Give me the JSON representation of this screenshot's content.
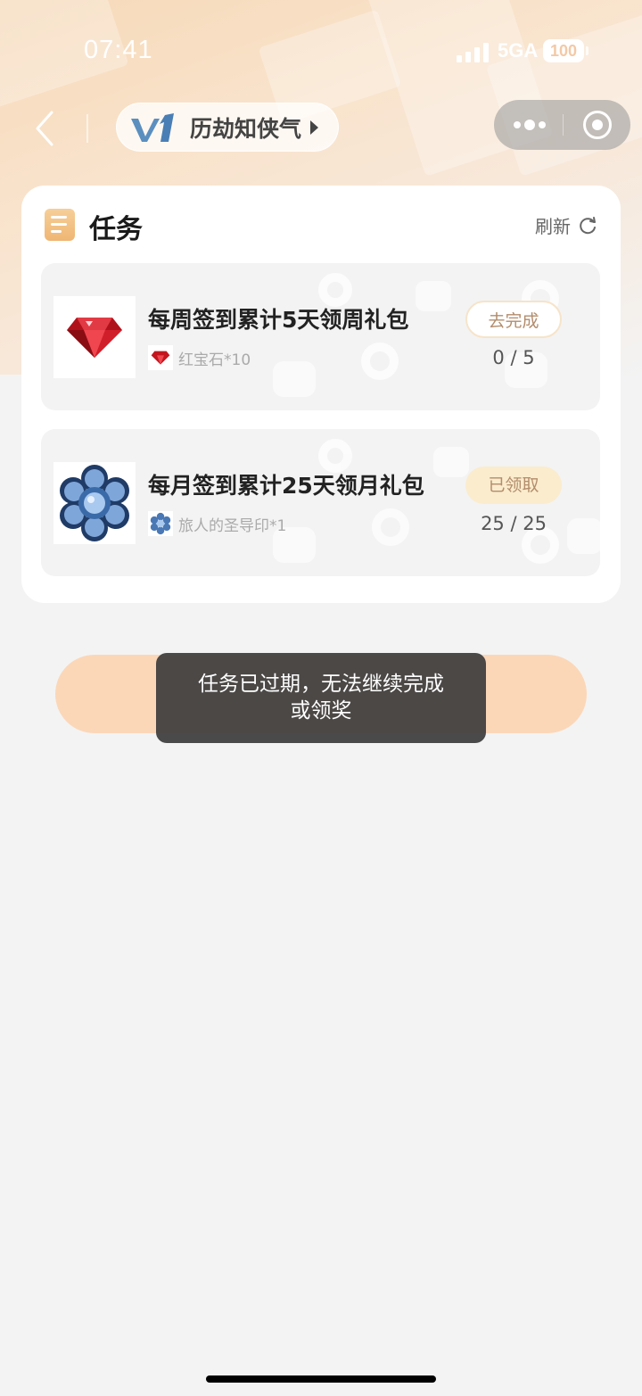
{
  "status_bar": {
    "time": "07:41",
    "network": "5GA",
    "battery": "100"
  },
  "nav": {
    "badge": "V1",
    "title": "历劫知侠气"
  },
  "section": {
    "title": "任务",
    "refresh_label": "刷新"
  },
  "tasks": [
    {
      "title": "每周签到累计5天领周礼包",
      "reward": "红宝石*10",
      "status": "去完成",
      "progress": "0 / 5"
    },
    {
      "title": "每月签到累计25天领月礼包",
      "reward": "旅人的圣导印*1",
      "status": "已领取",
      "progress": "25 / 25"
    }
  ],
  "toast": {
    "line1": "任务已过期，无法继续完成",
    "line2": "或领奖"
  },
  "colors": {
    "accent": "#fbd7b8",
    "button_text": "#b38c6b",
    "toast_bg": "#3c3c3c"
  }
}
